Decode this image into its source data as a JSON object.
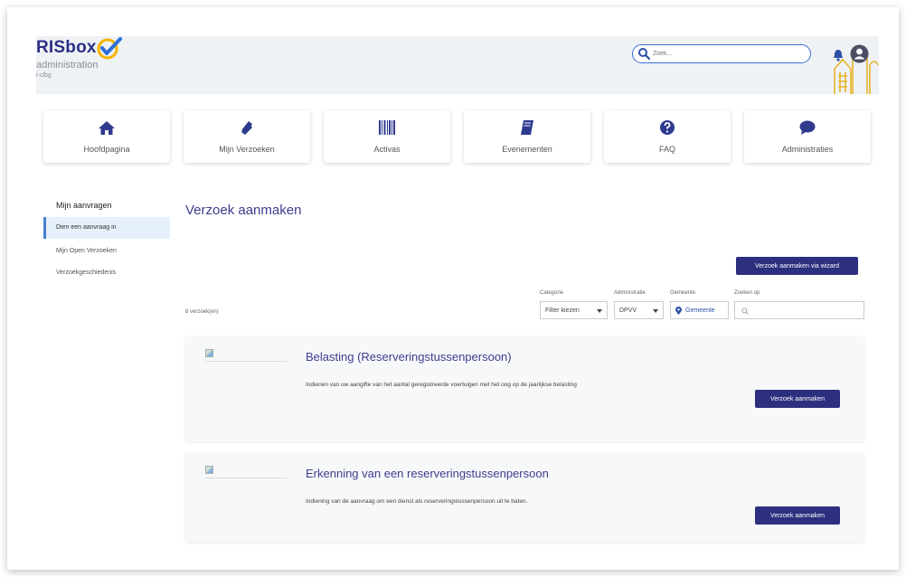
{
  "brand": {
    "name": "RISbox",
    "subtitle": "administration",
    "tenant": "i-clbg"
  },
  "search": {
    "placeholder": "Zoek..."
  },
  "nav": {
    "items": [
      {
        "label": "Hoofdpagina",
        "icon": "home-icon"
      },
      {
        "label": "Mijn Verzoeken",
        "icon": "ticket-icon"
      },
      {
        "label": "Activas",
        "icon": "barcode-icon"
      },
      {
        "label": "Evenementen",
        "icon": "book-icon"
      },
      {
        "label": "FAQ",
        "icon": "question-icon"
      },
      {
        "label": "Administraties",
        "icon": "chat-icon"
      }
    ]
  },
  "sidebar": {
    "title": "Mijn aanvragen",
    "items": [
      {
        "label": "Dien een aanvraag in",
        "active": true
      },
      {
        "label": "Mijn Open Verzoeken",
        "active": false
      },
      {
        "label": "Verzoekgeschiedenis",
        "active": false
      }
    ]
  },
  "main": {
    "title": "Verzoek aanmaken",
    "wizard_button": "Verzoek aanmaken via wizard",
    "count": "8 verzoek(en)",
    "filters": {
      "category_label": "Categorie",
      "category_value": "Filter kiezen",
      "administration_label": "Administratie",
      "administration_value": "DPVV",
      "municipality_label": "Gemeente",
      "municipality_value": "Gemeente",
      "search_label": "Zoeken op",
      "search_value": ""
    },
    "cards": [
      {
        "title": "Belasting (Reserveringstussenpersoon)",
        "description": "Indienen van uw aangifte van het aantal geregistreerde voertuigen met het oog op de jaarlijkse belasting",
        "button": "Verzoek aanmaken"
      },
      {
        "title": "Erkenning van een reserveringstussenpersoon",
        "description": "Indiening van de aanvraag om een dienst als reserveringstussenpersoon uit te baten.",
        "button": "Verzoek aanmaken"
      }
    ]
  },
  "colors": {
    "primary": "#2d2f7f",
    "title": "#3d3d8f",
    "accent": "#f5b400",
    "link_blue": "#3b6fd6",
    "header_bg": "#eef2f5"
  }
}
